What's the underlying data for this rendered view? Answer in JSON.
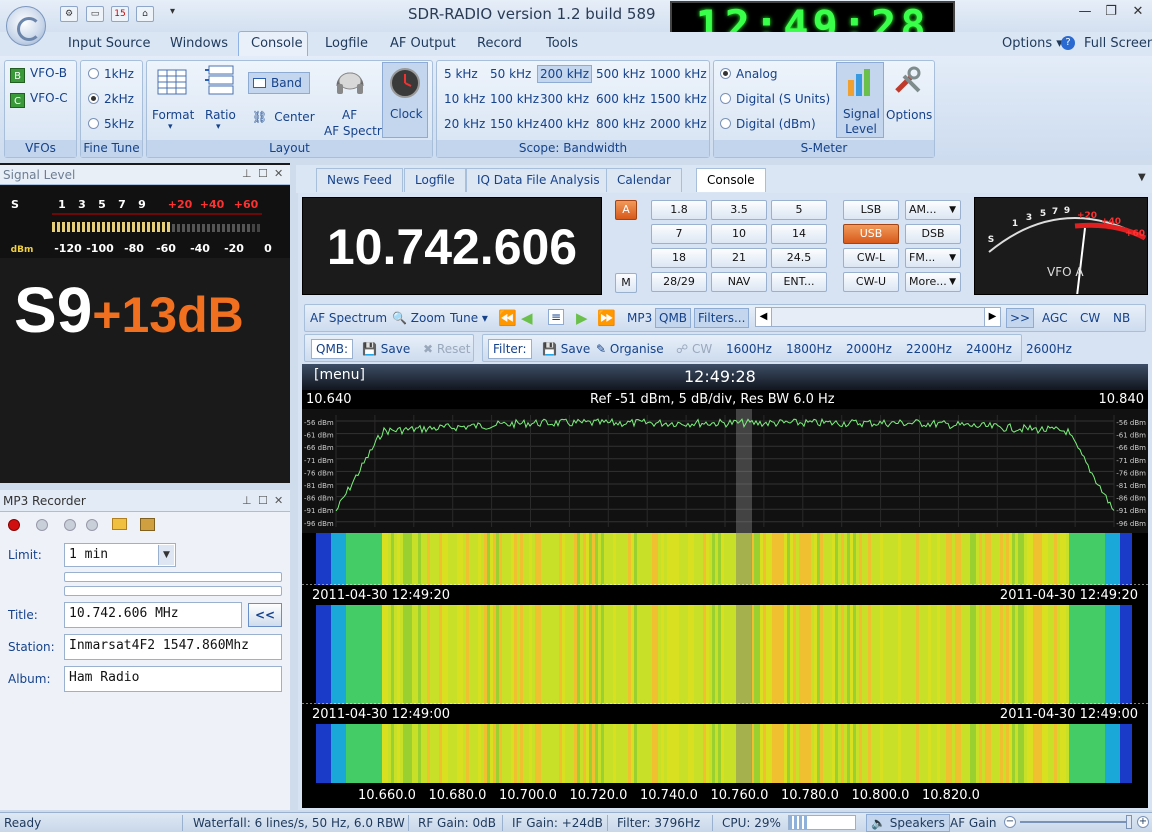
{
  "window": {
    "title": "SDR-RADIO version 1.2  build 589",
    "clock": "12:49:28"
  },
  "menus": [
    "Input Source",
    "Windows",
    "Console",
    "Logfile",
    "AF Output",
    "Record",
    "Tools"
  ],
  "menu_right": {
    "options": "Options",
    "full_screen": "Full Screen"
  },
  "ribbon": {
    "vfos": {
      "label": "VFOs",
      "items": [
        "VFO-B",
        "VFO-C"
      ],
      "badges": [
        "B",
        "C"
      ]
    },
    "fine_tune": {
      "label": "Fine Tune",
      "items": [
        "1kHz",
        "2kHz",
        "5kHz"
      ],
      "selected": "2kHz"
    },
    "layout": {
      "label": "Layout",
      "format": "Format",
      "ratio": "Ratio",
      "band": "Band",
      "center": "Center",
      "af_spectrum": "AF Spectrum",
      "clock": "Clock"
    },
    "scope": {
      "label": "Scope: Bandwidth",
      "rows": [
        [
          "5 kHz",
          "50 kHz",
          "200 kHz",
          "500 kHz",
          "1000 kHz"
        ],
        [
          "10 kHz",
          "100 kHz",
          "300 kHz",
          "600 kHz",
          "1500 kHz"
        ],
        [
          "20 kHz",
          "150 kHz",
          "400 kHz",
          "800 kHz",
          "2000 kHz"
        ]
      ],
      "selected": "200 kHz"
    },
    "smeter": {
      "label": "S-Meter",
      "items": [
        "Analog",
        "Digital (S Units)",
        "Digital (dBm)"
      ],
      "selected": "Analog",
      "signal_level": "Signal Level",
      "options": "Options"
    }
  },
  "signal_panel": {
    "title": "Signal Level",
    "scale_s": [
      "S",
      "1",
      "3",
      "5",
      "7",
      "9",
      "+20",
      "+40",
      "+60"
    ],
    "scale_dbm": [
      "dBm",
      "-120",
      "-100",
      "-80",
      "-60",
      "-40",
      "-20",
      "0"
    ],
    "reading_s": "S9",
    "reading_db": "+13dB"
  },
  "mp3_recorder": {
    "title": "MP3 Recorder",
    "limit_label": "Limit:",
    "limit_value": "1 min",
    "title_label": "Title:",
    "title_value": "10.742.606 MHz",
    "copy_button": "<<",
    "station_label": "Station:",
    "station_value": "Inmarsat4F2 1547.860Mhz",
    "album_label": "Album:",
    "album_value": "Ham Radio"
  },
  "doc_tabs": [
    "News Feed",
    "Logfile",
    "IQ Data File Analysis",
    "Calendar",
    "Console"
  ],
  "doc_tab_active": "Console",
  "console": {
    "frequency": "10.742.606",
    "btn_a": "A",
    "btn_m": "M",
    "bands": [
      [
        "1.8",
        "3.5",
        "5"
      ],
      [
        "7",
        "10",
        "14"
      ],
      [
        "18",
        "21",
        "24.5"
      ],
      [
        "28/29",
        "NAV",
        "ENT..."
      ]
    ],
    "modes": [
      [
        "LSB",
        "AM..."
      ],
      [
        "USB",
        "DSB"
      ],
      [
        "CW-L",
        "FM..."
      ],
      [
        "CW-U",
        "More..."
      ]
    ],
    "active_mode": "USB",
    "meter_scale": [
      "S",
      "1",
      "3",
      "5",
      "7",
      "9",
      "+20",
      "+40",
      "+60"
    ],
    "vfo_label": "VFO A"
  },
  "toolbar1": {
    "af_spectrum": "AF Spectrum",
    "zoom": "Zoom",
    "tune": "Tune",
    "mp3": "MP3",
    "qmb": "QMB",
    "filters": "Filters...",
    "more": ">>",
    "agc": "AGC",
    "cw": "CW",
    "nb": "NB"
  },
  "toolbar2": {
    "qmb": "QMB:",
    "save": "Save",
    "reset": "Reset",
    "filter": "Filter:",
    "save2": "Save",
    "organise": "Organise",
    "cw": "CW",
    "widths": [
      "1600Hz",
      "1800Hz",
      "2000Hz",
      "2200Hz",
      "2400Hz",
      "2600Hz"
    ]
  },
  "spectrum": {
    "menu": "[menu]",
    "time": "12:49:28",
    "start": "10.640",
    "end": "10.840",
    "info": "Ref -51 dBm,  5 dB/div,  Res BW 6.0 Hz",
    "db_labels": [
      "-56 dBm",
      "-61 dBm",
      "-66 dBm",
      "-71 dBm",
      "-76 dBm",
      "-81 dBm",
      "-86 dBm",
      "-91 dBm",
      "-96 dBm"
    ],
    "timestamps": [
      "2011-04-30  12:49:20",
      "2011-04-30  12:49:00"
    ],
    "axis": [
      "10.660.0",
      "10.680.0",
      "10.700.0",
      "10.720.0",
      "10.740.0",
      "10.760.0",
      "10.780.0",
      "10.800.0",
      "10.820.0"
    ]
  },
  "status": {
    "ready": "Ready",
    "waterfall": "Waterfall: 6 lines/s, 50 Hz, 6.0 RBW",
    "rf_gain": "RF Gain: 0dB",
    "if_gain": "IF Gain: +24dB",
    "filter": "Filter: 3796Hz",
    "cpu": "CPU: 29%",
    "speakers": "Speakers",
    "af_gain": "AF Gain"
  },
  "colors": {
    "accent": "#15428b",
    "clock_green": "#3aff4a",
    "signal_orange": "#f07020",
    "usb_orange": "#d65a1a"
  }
}
